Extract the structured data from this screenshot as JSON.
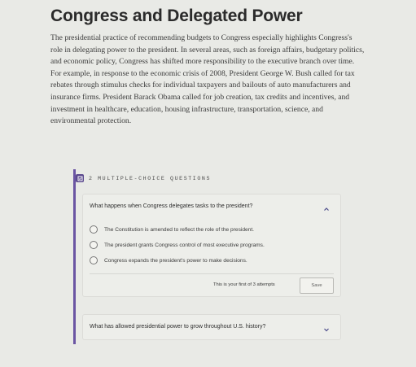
{
  "article": {
    "title": "Congress and Delegated Power",
    "paragraph": "The presidential practice of recommending budgets to Congress especially highlights Congress's role in delegating power to the president. In several areas, such as foreign affairs, budgetary politics, and economic policy, Congress has shifted more responsibility to the executive branch over time. For example, in response to the economic crisis of 2008, President George W. Bush called for tax rebates through stimulus checks for individual taxpayers and bailouts of auto manufacturers and insurance firms. President Barack Obama called for job creation, tax credits and incentives, and investment in healthcare, education, housing infrastructure, transportation, science, and environmental protection."
  },
  "quiz": {
    "header": "2 MULTIPLE-CHOICE QUESTIONS",
    "header_icon": "quiz-icon",
    "accent_color": "#6b55a3",
    "questions": [
      {
        "text": "What happens when Congress delegates tasks to the president?",
        "expanded": true,
        "options": [
          "The Constitution is amended to reflect the role of the president.",
          "The president grants Congress control of most executive programs.",
          "Congress expands the president's power to make decisions."
        ],
        "attempts_text": "This is your first of 3 attempts",
        "save_label": "Save"
      },
      {
        "text": "What has allowed presidential power to grow throughout U.S. history?",
        "expanded": false
      }
    ]
  }
}
